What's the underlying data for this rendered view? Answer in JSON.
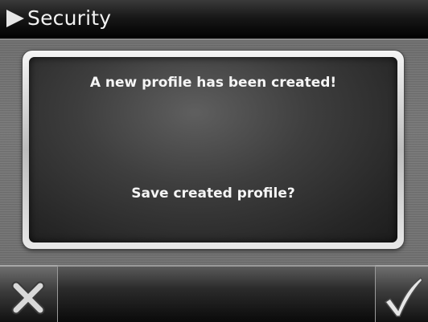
{
  "header": {
    "title": "Security",
    "icon": "play-arrow-icon"
  },
  "dialog": {
    "message": "A new profile has been created!",
    "question": "Save created profile?"
  },
  "toolbar": {
    "cancel_icon": "close-icon",
    "confirm_icon": "checkmark-icon"
  },
  "colors": {
    "header_bg": "#000000",
    "dialog_bg": "#3e3e3e",
    "frame": "#d0d0d0",
    "text": "#f5f5f5"
  }
}
